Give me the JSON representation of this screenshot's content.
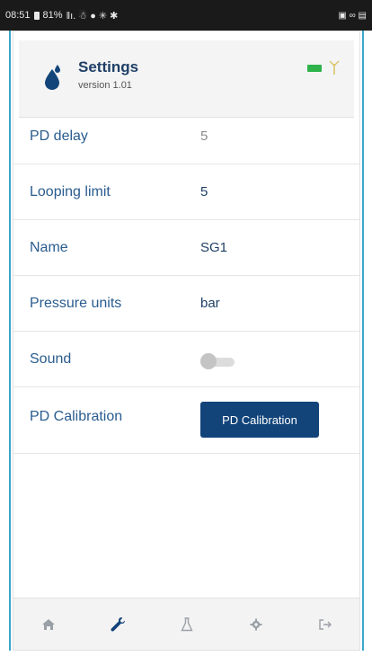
{
  "status_bar": {
    "time": "08:51",
    "battery_percent": "81%",
    "left_icons": "ǁı. ☃ ● ✳ ✱",
    "right_icons": "▣ ∞ ▤"
  },
  "header": {
    "title": "Settings",
    "version": "version 1.01",
    "icons": [
      "drop-icon",
      "battery-icon",
      "antenna-icon"
    ],
    "battery_color": "#2db34a"
  },
  "settings": [
    {
      "label": "PD delay",
      "value": "5",
      "muted": true
    },
    {
      "label": "Looping limit",
      "value": "5"
    },
    {
      "label": "Name",
      "value": "SG1"
    },
    {
      "label": "Pressure units",
      "value": "bar"
    },
    {
      "label": "Sound",
      "toggle": "off"
    },
    {
      "label": "PD Calibration",
      "button": "PD Calibration"
    }
  ],
  "bottom_nav": [
    "home-icon",
    "wrench-icon",
    "flask-icon",
    "gear-icon",
    "logout-icon"
  ],
  "colors": {
    "accent": "#12447a",
    "label": "#2a5c8e",
    "frame": "#3aa7c9"
  }
}
